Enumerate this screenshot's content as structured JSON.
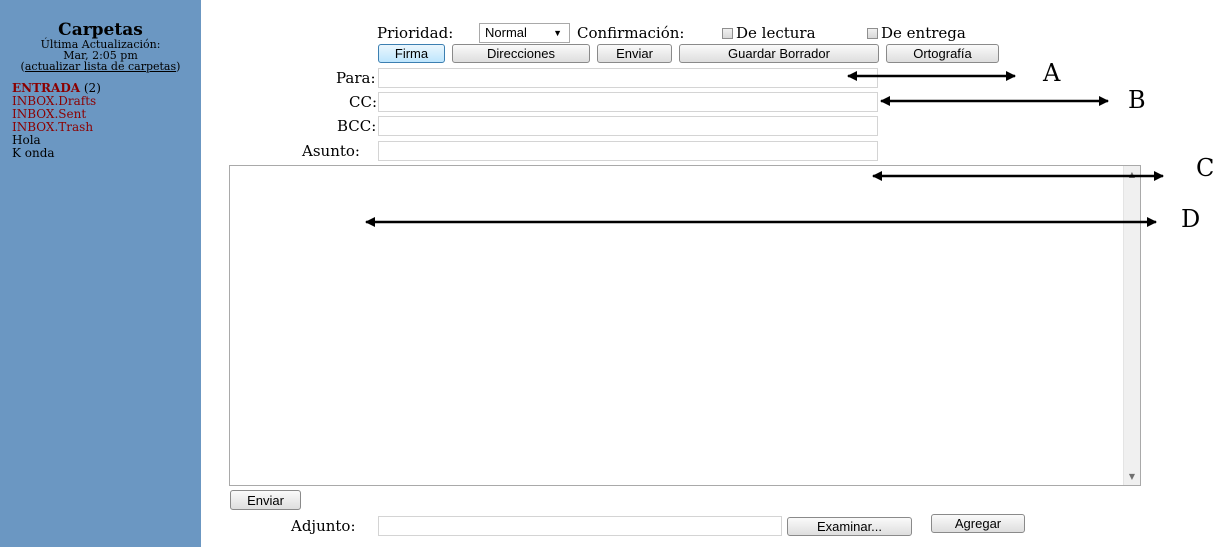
{
  "sidebar": {
    "title": "Carpetas",
    "last_update_label": "Última Actualización:",
    "last_update_value": "Mar, 2:05 pm",
    "refresh_open": "(",
    "refresh_link": "actualizar lista de carpetas",
    "refresh_close": ")",
    "folders": [
      {
        "name": "ENTRADA",
        "count": "(2)"
      },
      {
        "name": "INBOX.Drafts"
      },
      {
        "name": "INBOX.Sent"
      },
      {
        "name": "INBOX.Trash"
      },
      {
        "name": "Hola"
      },
      {
        "name": "K onda"
      }
    ]
  },
  "options": {
    "priority_label": "Prioridad:",
    "priority_value": "Normal",
    "confirmation_label": "Confirmación:",
    "read_receipt_label": "De lectura",
    "delivery_receipt_label": "De entrega"
  },
  "toolbar": {
    "signature": "Firma",
    "addresses": "Direcciones",
    "send": "Enviar",
    "save_draft": "Guardar Borrador",
    "spelling": "Ortografía"
  },
  "fields": {
    "to_label": "Para:",
    "to_value": "",
    "cc_label": "CC:",
    "cc_value": "",
    "bcc_label": "BCC:",
    "bcc_value": "",
    "subject_label": "Asunto:",
    "subject_value": "",
    "body_value": ""
  },
  "footer": {
    "send": "Enviar",
    "attachment_label": "Adjunto:",
    "attachment_value": "",
    "browse": "Examinar...",
    "add": "Agregar"
  },
  "annotations": [
    "A",
    "B",
    "C",
    "D"
  ]
}
